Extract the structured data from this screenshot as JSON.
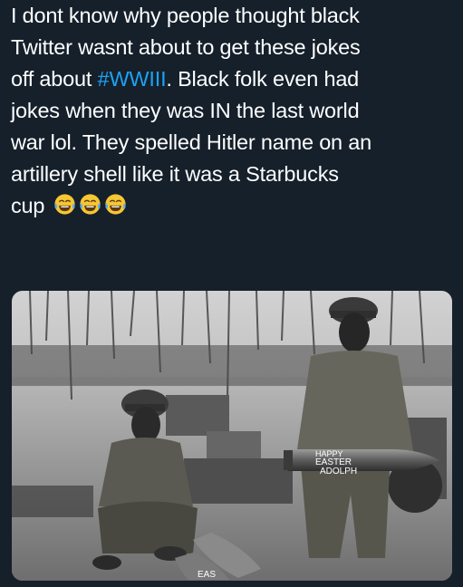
{
  "tweet": {
    "text_line_1": "I dont know why people thought black",
    "text_line_2": "Twitter wasnt about to get these jokes",
    "text_line_3_before": "off about ",
    "hashtag": "#WWIII",
    "text_line_3_after": ". Black folk even had",
    "text_line_4": "jokes when they was IN the last world",
    "text_line_5": "war lol. They spelled Hitler name on an",
    "text_line_6": "artillery shell like it was a Starbucks",
    "text_line_7": "cup",
    "emojis": [
      "face-with-tears-of-joy-icon",
      "face-with-tears-of-joy-icon",
      "face-with-tears-of-joy-icon"
    ]
  },
  "photo": {
    "shell_text_line_1": "HAPPY",
    "shell_text_line_2": "EASTER",
    "shell_text_line_3": "ADOLPH",
    "ground_shell_text": "EAS"
  },
  "colors": {
    "background": "#15202b",
    "text": "#ffffff",
    "hashtag": "#1da1f2",
    "emoji_face": "#f6c634"
  }
}
